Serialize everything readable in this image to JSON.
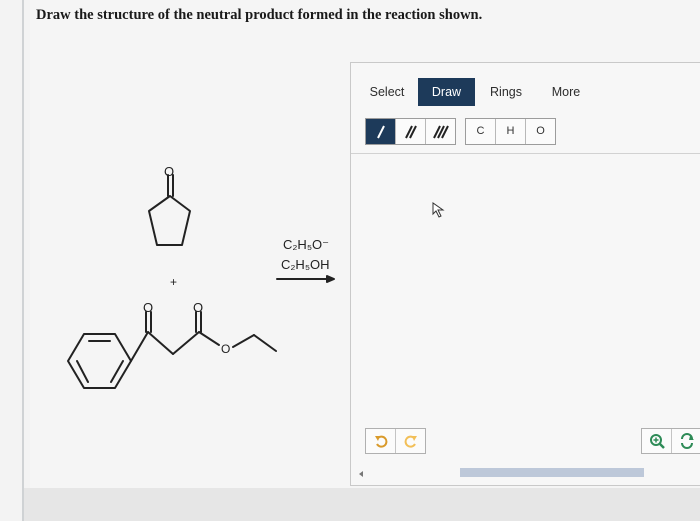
{
  "question": {
    "text": "Draw the structure of the neutral product formed in the reaction shown."
  },
  "reaction": {
    "plus": "+",
    "reagent1": "C₂H₅O⁻",
    "reagent2": "C₂H₅OH",
    "atom_O": "O"
  },
  "editor": {
    "tabs": [
      "Select",
      "Draw",
      "Rings",
      "More"
    ],
    "active_tab": "Draw",
    "bond_tools": [
      "single-bond",
      "double-bond",
      "triple-bond"
    ],
    "active_bond": "single-bond",
    "atoms": [
      "C",
      "H",
      "O"
    ],
    "accent_color": "#1d3a5a",
    "undo_color": "#d99a2b",
    "redo_color": "#f2bf58",
    "zoom_color": "#2e8b57"
  }
}
